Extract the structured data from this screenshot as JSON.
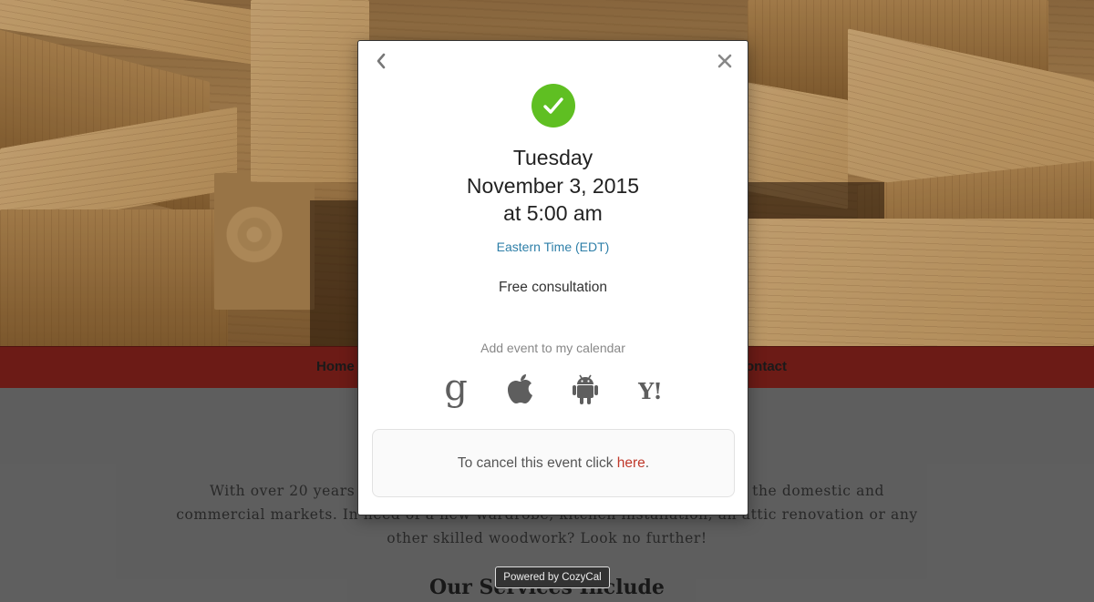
{
  "background_page": {
    "nav": {
      "home_label": "Home",
      "contact_label": "ontact"
    },
    "intro_text": "With over 20 years of experience, we deliver quality workmanship for the domestic and commercial markets. In need of a new wardrobe, kitchen installation, an attic renovation or any other skilled woodwork? Look no further!",
    "services_title": "Our Services Include",
    "colors": {
      "navbar": "#7b1f1a"
    }
  },
  "modal": {
    "back_icon": "chevron-left-icon",
    "close_icon": "close-icon",
    "success_icon": "check-circle-icon",
    "date": {
      "weekday": "Tuesday",
      "full_date": "November 3, 2015",
      "time": "at 5:00 am"
    },
    "timezone_label": "Eastern Time (EDT)",
    "event_name": "Free consultation",
    "add_calendar_label": "Add event to my calendar",
    "calendar_options": [
      {
        "name": "Google",
        "icon": "google-icon",
        "glyph": "g"
      },
      {
        "name": "Apple",
        "icon": "apple-icon"
      },
      {
        "name": "Android",
        "icon": "android-icon"
      },
      {
        "name": "Yahoo",
        "icon": "yahoo-icon",
        "glyph": "Y!"
      }
    ],
    "cancel": {
      "text_before": "To cancel this event click ",
      "link_text": "here",
      "text_after": "."
    },
    "colors": {
      "success": "#5fbf22",
      "link": "#2e7fa8",
      "cancel_link": "#c0392b"
    }
  },
  "powered_by": "Powered by CozyCal"
}
